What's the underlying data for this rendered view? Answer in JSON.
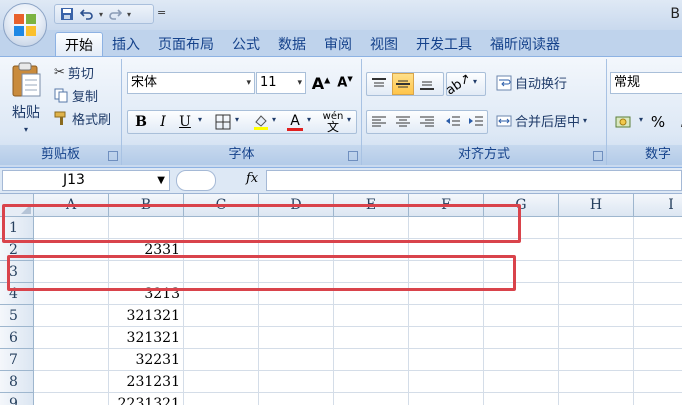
{
  "titlebar": {
    "window_title_fragment": "B",
    "qat_extra": "="
  },
  "tabs": [
    {
      "label": "开始",
      "active": true
    },
    {
      "label": "插入",
      "active": false
    },
    {
      "label": "页面布局",
      "active": false
    },
    {
      "label": "公式",
      "active": false
    },
    {
      "label": "数据",
      "active": false
    },
    {
      "label": "审阅",
      "active": false
    },
    {
      "label": "视图",
      "active": false
    },
    {
      "label": "开发工具",
      "active": false
    },
    {
      "label": "福昕阅读器",
      "active": false
    }
  ],
  "ribbon": {
    "clipboard": {
      "label": "剪贴板",
      "paste": "粘贴",
      "cut": "剪切",
      "copy": "复制",
      "format_painter": "格式刷"
    },
    "font": {
      "label": "字体",
      "font_name": "宋体",
      "font_size": "11",
      "bold": "B",
      "italic": "I",
      "underline": "U",
      "font_color_glyph": "A",
      "phonetic_glyph": "wén"
    },
    "alignment": {
      "label": "对齐方式",
      "wrap_text": "自动换行",
      "merge_center": "合并后居中"
    },
    "number": {
      "label": "数字",
      "format": "常规",
      "percent": "%"
    }
  },
  "formulabar": {
    "cell_ref": "J13",
    "fx": "fx",
    "formula": ""
  },
  "grid": {
    "columns": [
      "A",
      "B",
      "C",
      "D",
      "E",
      "F",
      "G",
      "H",
      "I"
    ],
    "rows": [
      {
        "num": "1",
        "b": ""
      },
      {
        "num": "2",
        "b": "2331"
      },
      {
        "num": "3",
        "b": ""
      },
      {
        "num": "4",
        "b": "3213"
      },
      {
        "num": "5",
        "b": "321321"
      },
      {
        "num": "6",
        "b": "321321"
      },
      {
        "num": "7",
        "b": "32231"
      },
      {
        "num": "8",
        "b": "231231"
      },
      {
        "num": "9",
        "b": "2231321"
      }
    ]
  },
  "colors": {
    "highlight": "#d9434b",
    "ribbon_accent": "#15428b",
    "pressed": "#ffc54a"
  }
}
